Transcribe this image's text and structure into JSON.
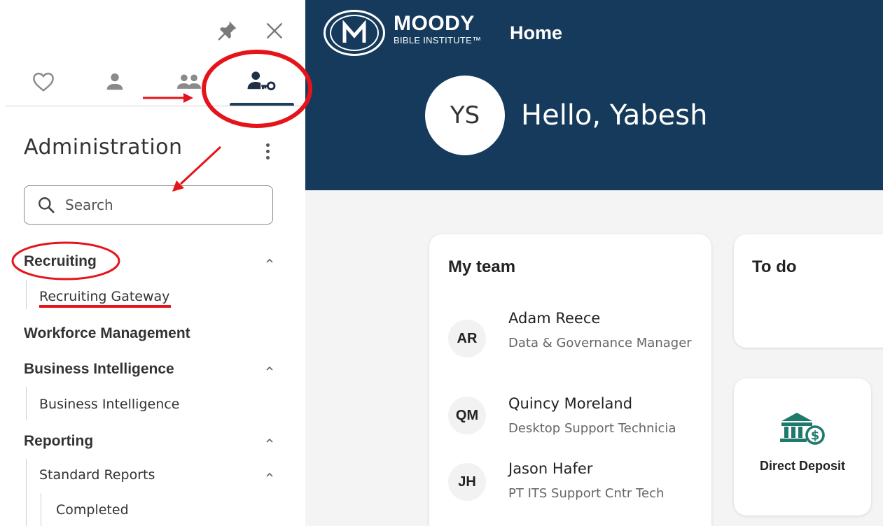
{
  "sidebar": {
    "title": "Administration",
    "search": {
      "placeholder": "Search"
    },
    "tabs": [
      "favorites",
      "me",
      "my-team",
      "administration"
    ],
    "active_tab": "administration",
    "sections": [
      {
        "label": "Recruiting",
        "expanded": true,
        "items": [
          {
            "label": "Recruiting Gateway"
          }
        ]
      },
      {
        "label": "Workforce Management",
        "expanded": false,
        "items": []
      },
      {
        "label": "Business Intelligence",
        "expanded": true,
        "items": [
          {
            "label": "Business Intelligence"
          }
        ]
      },
      {
        "label": "Reporting",
        "expanded": true,
        "items": [
          {
            "label": "Standard Reports",
            "expanded": true,
            "items": [
              {
                "label": "Completed"
              }
            ]
          }
        ]
      }
    ]
  },
  "header": {
    "brand_name": "MOODY",
    "brand_sub": "BIBLE INSTITUTE™",
    "page_title": "Home",
    "avatar_initials": "YS",
    "greeting": "Hello, Yabesh",
    "background_color": "#153a5b"
  },
  "main": {
    "my_team": {
      "title": "My team",
      "members": [
        {
          "initials": "AR",
          "name": "Adam Reece",
          "role": "Data & Governance Manager"
        },
        {
          "initials": "QM",
          "name": "Quincy Moreland",
          "role": "Desktop Support Technicia"
        },
        {
          "initials": "JH",
          "name": "Jason Hafer",
          "role": "PT ITS Support Cntr Tech"
        }
      ]
    },
    "todo": {
      "title": "To do"
    },
    "direct_deposit": {
      "label": "Direct Deposit",
      "icon": "bank-dollar-icon",
      "icon_color": "#1f7a6b"
    }
  },
  "annotations": {
    "color": "#e5141b"
  }
}
